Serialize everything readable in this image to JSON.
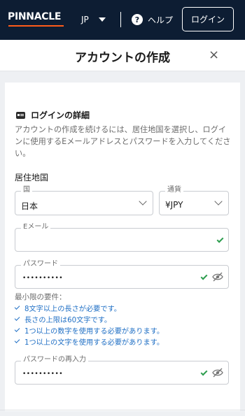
{
  "topbar": {
    "logo": "PINNACLE",
    "language": "JP",
    "help_label": "ヘルプ",
    "help_icon_glyph": "?",
    "login_label": "ログイン"
  },
  "header": {
    "title": "アカウントの作成",
    "close_glyph": "×"
  },
  "section": {
    "title": "ログインの詳細",
    "description": "アカウントの作成を続けるには、居住地国を選択し、ログインに使用するEメールアドレスとパスワードを入力してください。",
    "country_label": "居住地国"
  },
  "fields": {
    "country": {
      "label": "国",
      "value": "日本"
    },
    "currency": {
      "label": "通貨",
      "value": "¥JPY"
    },
    "email": {
      "label": "Eメール",
      "value": ""
    },
    "password": {
      "label": "パスワード",
      "value": "••••••••••"
    },
    "password_confirm": {
      "label": "パスワードの再入力",
      "value": "••••••••••"
    }
  },
  "requirements": {
    "title": "最小限の要件：",
    "items": [
      "8文字以上の長さが必要です。",
      "長さの上限は60文字です。",
      "1つ以上の数字を使用する必要があります。",
      "1つ以上の文字を使用する必要があります。"
    ]
  },
  "colors": {
    "topbar_bg": "#0d1d33",
    "logo_underline": "#ff5b1a",
    "valid_check": "#2e9e4f",
    "requirement_text": "#1f6fc5"
  }
}
